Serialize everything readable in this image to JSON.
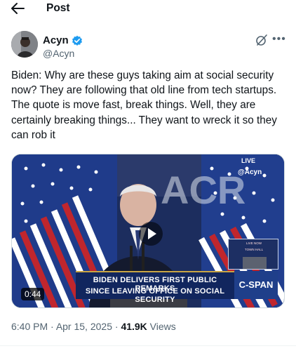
{
  "topbar": {
    "title": "Post"
  },
  "author": {
    "name": "Acyn",
    "handle": "@Acyn"
  },
  "tweet": {
    "text": "Biden: Why are these guys taking aim at social security now? They are following that old line from tech startups. The quote is move fast, break things. Well, they are certainly breaking things... They want to wreck it so they can rob it"
  },
  "video": {
    "duration": "0:44",
    "chyron_line1": "BIDEN DELIVERS FIRST PUBLIC REMARKS",
    "chyron_line2": "SINCE LEAVING OFFICE ON SOCIAL SECURITY",
    "network": "C-SPAN",
    "live_badge": "LIVE",
    "overlay_handle": "@Acyn",
    "inset_line1": "LIVE NOW",
    "inset_line2": "TOWN HALL",
    "backdrop_text": "ACR"
  },
  "meta": {
    "time": "6:40 PM",
    "separator1": " · ",
    "date": "Apr 15, 2025",
    "separator2": " · ",
    "views_count": "41.9K",
    "views_label": " Views"
  },
  "colors": {
    "verified": "#1d9bf0",
    "secondary_text": "#536471",
    "primary_text": "#0f1419"
  },
  "icons": {
    "back": "arrow-left-icon",
    "verified": "verified-badge-icon",
    "grok": "grok-icon",
    "more": "more-horizontal-icon",
    "play": "play-icon"
  }
}
